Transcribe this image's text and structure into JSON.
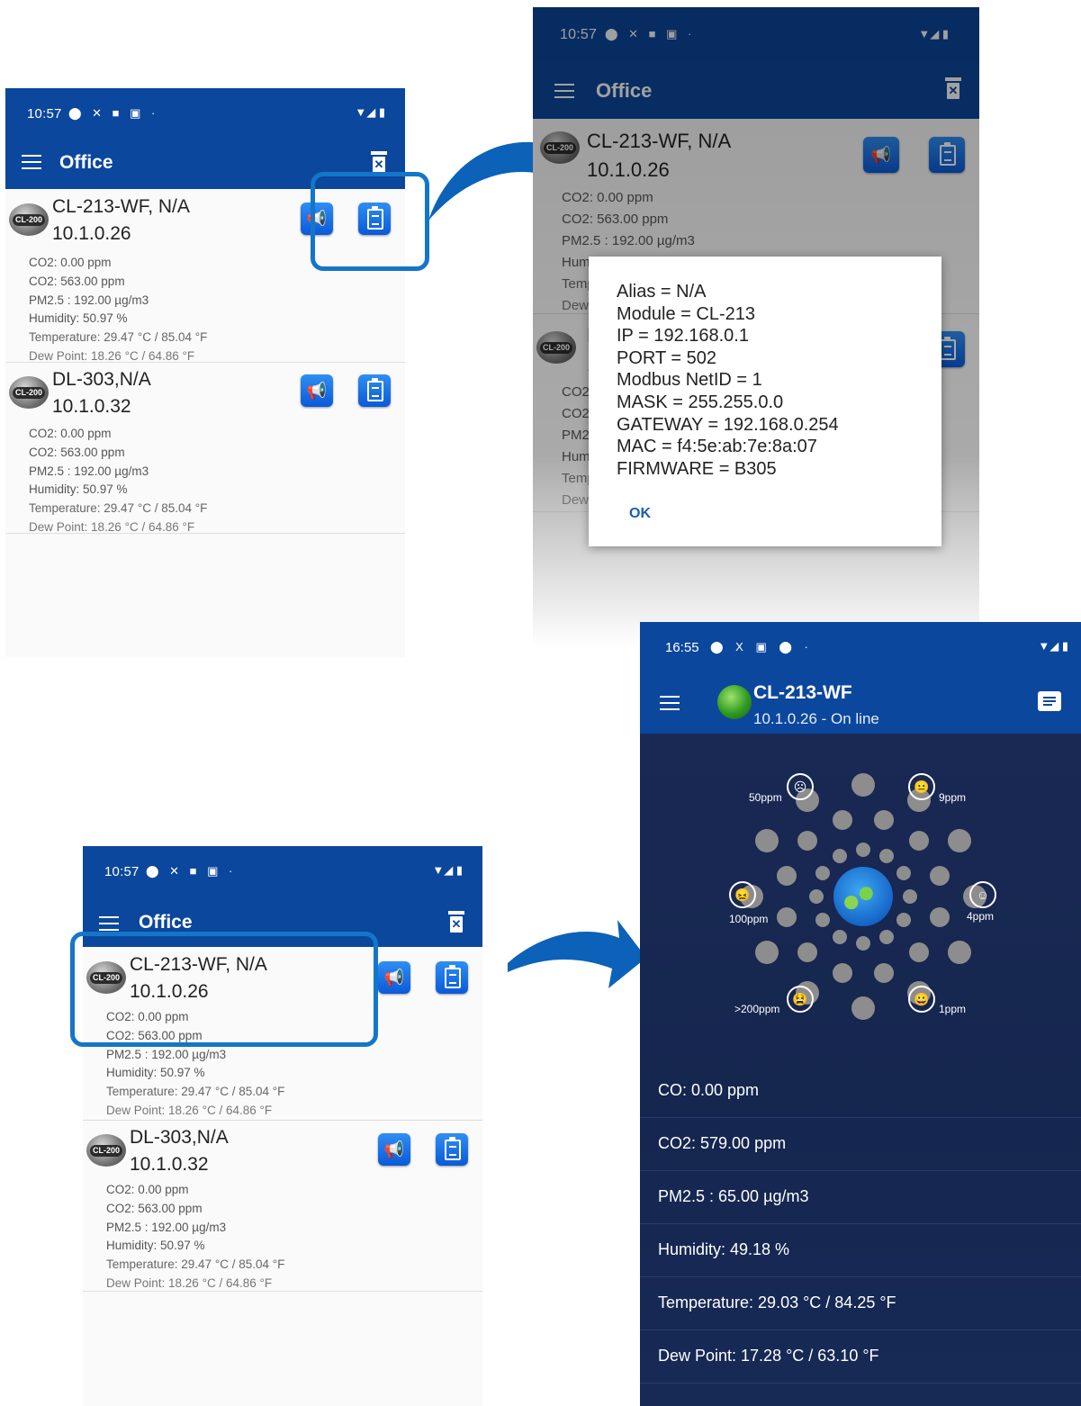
{
  "status_time_a": "10:57",
  "status_time_b": "16:55",
  "office_title": "Office",
  "devices": [
    {
      "name": "CL-213-WF, N/A",
      "ip": "10.1.0.26",
      "readings": [
        "CO2: 0.00 ppm",
        "CO2: 563.00 ppm",
        "PM2.5 : 192.00 µg/m3",
        "Humidity: 50.97 %",
        "Temperature: 29.47 °C / 85.04 °F",
        "Dew Point: 18.26 °C / 64.86 °F"
      ]
    },
    {
      "name": "DL-303,N/A",
      "ip": "10.1.0.32",
      "readings": [
        "CO2: 0.00 ppm",
        "CO2: 563.00 ppm",
        "PM2.5 : 192.00 µg/m3",
        "Humidity: 50.97 %",
        "Temperature: 29.47 °C / 85.04 °F",
        "Dew Point: 18.26 °C / 64.86 °F"
      ]
    }
  ],
  "logo_text": "CL-200",
  "dialog": {
    "lines": [
      "Alias = N/A",
      "Module = CL-213",
      "IP = 192.168.0.1",
      "PORT = 502",
      "Modbus NetID = 1",
      "MASK = 255.255.0.0",
      "GATEWAY = 192.168.0.254",
      "MAC = f4:5e:ab:7e:8a:07",
      "FIRMWARE = B305"
    ],
    "ok": "OK"
  },
  "detail": {
    "title": "CL-213-WF",
    "subtitle": "10.1.0.26 - On line",
    "faces": [
      {
        "label": "50ppm",
        "glyph": "☹"
      },
      {
        "label": "9ppm",
        "glyph": "😐"
      },
      {
        "label": "100ppm",
        "glyph": "😖"
      },
      {
        "label": "4ppm",
        "glyph": "☺"
      },
      {
        "label": ">200ppm",
        "glyph": "😫"
      },
      {
        "label": "1ppm",
        "glyph": "😀"
      }
    ],
    "readings": [
      "CO: 0.00 ppm",
      "CO2: 579.00 ppm",
      "PM2.5 : 65.00 µg/m3",
      "Humidity: 49.18 %",
      "Temperature: 29.03 °C / 84.25 °F",
      "Dew Point: 17.28 °C / 63.10 °F"
    ]
  },
  "colors": {
    "appbar": "#0b479c",
    "button": "#1670e6",
    "highlight": "#1476c8",
    "detail_bg": "#172a56"
  }
}
